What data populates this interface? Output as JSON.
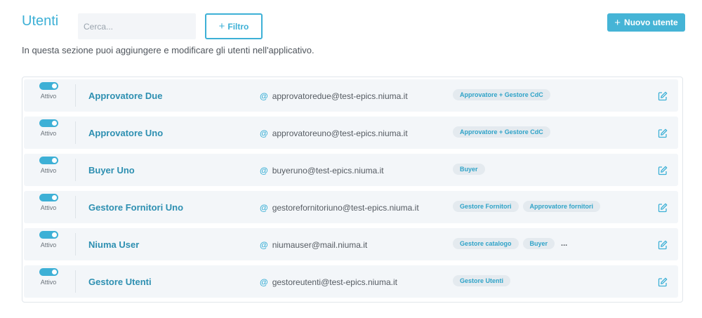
{
  "header": {
    "title": "Utenti",
    "search_placeholder": "Cerca...",
    "filter_label": "Filtro",
    "new_user_label": "Nuovo utente",
    "subtitle": "In questa sezione puoi aggiungere e modificare gli utenti nell'applicativo."
  },
  "colors": {
    "accent": "#3db0d6",
    "row_bg": "#f3f6f9",
    "tag_bg": "#e4eaef"
  },
  "users": [
    {
      "status": "Attivo",
      "name": "Approvatore Due",
      "email": "approvatoredue@test-epics.niuma.it",
      "roles": [
        "Approvatore + Gestore CdC"
      ]
    },
    {
      "status": "Attivo",
      "name": "Approvatore Uno",
      "email": "approvatoreuno@test-epics.niuma.it",
      "roles": [
        "Approvatore + Gestore CdC"
      ]
    },
    {
      "status": "Attivo",
      "name": "Buyer Uno",
      "email": "buyeruno@test-epics.niuma.it",
      "roles": [
        "Buyer"
      ]
    },
    {
      "status": "Attivo",
      "name": "Gestore Fornitori Uno",
      "email": "gestorefornitoriuno@test-epics.niuma.it",
      "roles": [
        "Gestore Fornitori",
        "Approvatore fornitori"
      ]
    },
    {
      "status": "Attivo",
      "name": "Niuma User",
      "email": "niumauser@mail.niuma.it",
      "roles": [
        "Gestore catalogo",
        "Buyer"
      ],
      "more": "..."
    },
    {
      "status": "Attivo",
      "name": "Gestore Utenti",
      "email": "gestoreutenti@test-epics.niuma.it",
      "roles": [
        "Gestore Utenti"
      ]
    }
  ]
}
